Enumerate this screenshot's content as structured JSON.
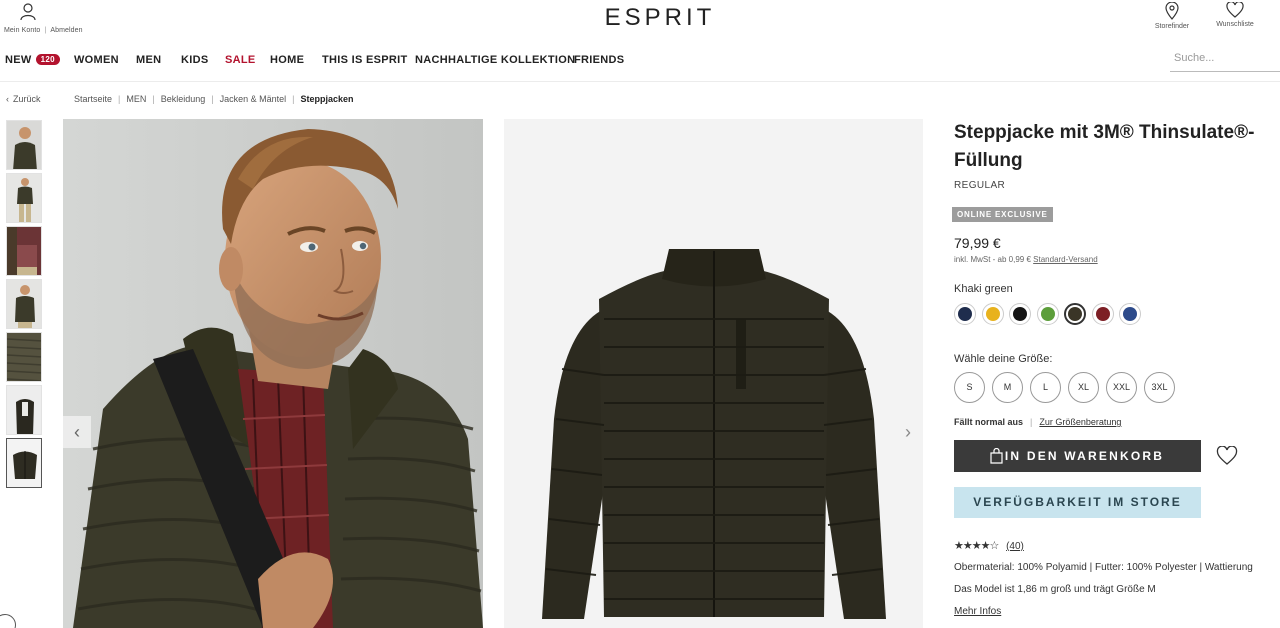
{
  "header": {
    "account_links": [
      "Mein Konto",
      "Abmelden"
    ],
    "logo": "ESPRIT",
    "storefinder_label": "Storefinder",
    "wishlist_label": "Wunschliste"
  },
  "nav": {
    "items": [
      {
        "label": "NEW",
        "badge": "120"
      },
      {
        "label": "WOMEN"
      },
      {
        "label": "MEN"
      },
      {
        "label": "KIDS"
      },
      {
        "label": "SALE",
        "accent": "#b3132e"
      },
      {
        "label": "HOME"
      },
      {
        "label": "THIS IS ESPRIT"
      },
      {
        "label": "NACHHALTIGE KOLLEKTION"
      },
      {
        "label": "FRIENDS"
      }
    ],
    "search_placeholder": "Suche..."
  },
  "breadcrumb": {
    "back_label": "Zurück",
    "items": [
      "Startseite",
      "MEN",
      "Bekleidung",
      "Jacken & Mäntel",
      "Steppjacken"
    ]
  },
  "gallery": {
    "thumbnail_count": 7,
    "active_thumbnail": 6
  },
  "product": {
    "title": "Steppjacke mit 3M® Thinsulate®-Füllung",
    "fit": "REGULAR",
    "badge": "ONLINE EXCLUSIVE",
    "price": "79,99 €",
    "tax_note": "inkl. MwSt - ab 0,99 €",
    "shipping_link": "Standard-Versand",
    "color_name": "Khaki green",
    "colors": [
      {
        "hex": "#1f2d4d",
        "selected": false
      },
      {
        "hex": "#e8b21d",
        "selected": false
      },
      {
        "hex": "#151515",
        "selected": false
      },
      {
        "hex": "#5c9e3a",
        "selected": false
      },
      {
        "hex": "#3a3527",
        "selected": true
      },
      {
        "hex": "#7d1f25",
        "selected": false
      },
      {
        "hex": "#2d4a8a",
        "selected": false
      }
    ],
    "size_label": "Wähle deine Größe:",
    "sizes": [
      "S",
      "M",
      "L",
      "XL",
      "XXL",
      "3XL"
    ],
    "fit_note": "Fällt normal aus",
    "size_advice_link": "Zur Größenberatung",
    "cart_button": "IN DEN WARENKORB",
    "store_button": "VERFÜGBARKEIT IM STORE",
    "rating": 4.5,
    "rating_stars": "★★★★☆",
    "review_count": "(40)",
    "material": "Obermaterial: 100% Polyamid | Futter: 100% Polyester | Wattierung",
    "model_info": "Das Model ist 1,86 m groß und trägt Größe M",
    "more_info": "Mehr Infos"
  }
}
